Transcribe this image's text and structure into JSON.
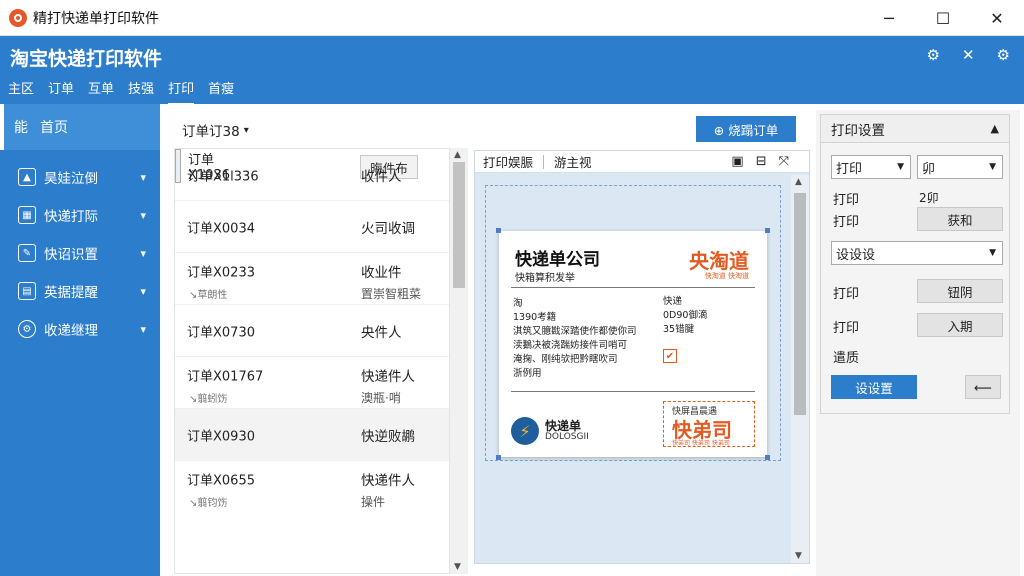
{
  "window": {
    "title": "精打快递单打印软件",
    "minimize": "─",
    "maximize": "☐",
    "close": "✕"
  },
  "header": {
    "title": "淘宝快递打印软件",
    "icons": [
      "⚙",
      "✕",
      "⚙"
    ]
  },
  "menu": {
    "items": [
      "主区",
      "订单",
      "互单",
      "技强",
      "打印",
      "首瘦"
    ],
    "active_index": 4
  },
  "sidebar": {
    "home": {
      "icon": "能",
      "label": "首页"
    },
    "items": [
      {
        "label": "昊娃泣倒",
        "icon": "cap-icon"
      },
      {
        "label": "快递打际",
        "icon": "box-icon"
      },
      {
        "label": "快诏识置",
        "icon": "edit-icon"
      },
      {
        "label": "英据提醒",
        "icon": "grid-icon"
      },
      {
        "label": "收递继理",
        "icon": "gear-icon"
      }
    ]
  },
  "orders": {
    "filter": "订单订38",
    "new_button": "⊕ 烧蹋订单",
    "rows": [
      {
        "id": "订单X1036",
        "status": "",
        "button": "晦件布",
        "sub": "",
        "sub2": ""
      },
      {
        "id": "订单X1l336",
        "status": "收件人",
        "button": "",
        "sub": "",
        "sub2": ""
      },
      {
        "id": "订单X0034",
        "status": "火司收调",
        "button": "",
        "sub": "",
        "sub2": ""
      },
      {
        "id": "订单X0233",
        "status": "收业件",
        "button": "",
        "sub": "↘草朗性",
        "sub2": "置崇智粗菜"
      },
      {
        "id": "订单X0730",
        "status": "央件人",
        "button": "",
        "sub": "",
        "sub2": ""
      },
      {
        "id": "订单X01767",
        "status": "快递件人",
        "button": "",
        "sub": "↘翦蚓饬",
        "sub2": "澳瓶·哨"
      },
      {
        "id": "订单X0930",
        "status": "快逆败鹕",
        "button": "",
        "sub": "",
        "sub2": ""
      },
      {
        "id": "订单X0655",
        "status": "快递件人",
        "button": "",
        "sub": "↘翦钧饬",
        "sub2": "操件"
      }
    ]
  },
  "preview": {
    "toolbar_left": "打印娱脤",
    "toolbar_mid": "游主视",
    "label": {
      "company": "快递单公司",
      "company_sub": "快箱算积发举",
      "logo": "央淘道",
      "logo_sub": "快淘道 快淘道",
      "left_lines": [
        "淘",
        "1390考籍",
        "淇筑又臆戡深踏使作都使你司",
        "渎鵝决被浇踹妨接件司哨可",
        "淹掬、刚纯欤把黔瞎吹司",
        "浙例用"
      ],
      "right_lines": [
        "快递",
        "0D90御滴",
        "35错腱"
      ],
      "check": "✔",
      "brand": "快递单",
      "brand_sub": "DOLOSGII",
      "stamp_top": "快屏昌晨遇",
      "stamp_main": "快弟司",
      "stamp_sub": "快弟司 快弟司 快弟司"
    }
  },
  "settings": {
    "title": "打印设置",
    "select1": "打印",
    "select2": "卯",
    "row1_label": "打印",
    "row1_value": "2卯",
    "row2_label": "打印",
    "row2_button": "获和",
    "select3": "设设设",
    "row3_label": "打印",
    "row3_button": "钮阴",
    "row4_label": "打印",
    "row4_button": "入期",
    "row5_label": "遣质",
    "apply_button": "设设置",
    "back_button": "⟵"
  }
}
